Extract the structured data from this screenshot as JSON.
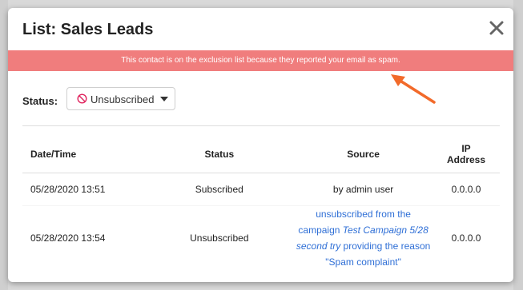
{
  "modal": {
    "title": "List: Sales Leads",
    "alert": "This contact is on the exclusion list because they reported your email as spam.",
    "status_label": "Status:",
    "status_value": "Unsubscribed",
    "colors": {
      "alert_bg": "#f07d7d",
      "link": "#2f6fd6",
      "arrow": "#f26a2a"
    },
    "table": {
      "headers": {
        "datetime": "Date/Time",
        "status": "Status",
        "source": "Source",
        "ip_line1": "IP",
        "ip_line2": "Address"
      },
      "rows": [
        {
          "datetime": "05/28/2020 13:51",
          "status": "Subscribed",
          "source": "by admin user",
          "ip": "0.0.0.0"
        },
        {
          "datetime": "05/28/2020 13:54",
          "status": "Unsubscribed",
          "source_prefix": "unsubscribed from the campaign",
          "source_campaign": "Test Campaign 5/28 second try",
          "source_suffix": "providing the reason \"Spam complaint\"",
          "ip": "0.0.0.0"
        }
      ]
    }
  }
}
